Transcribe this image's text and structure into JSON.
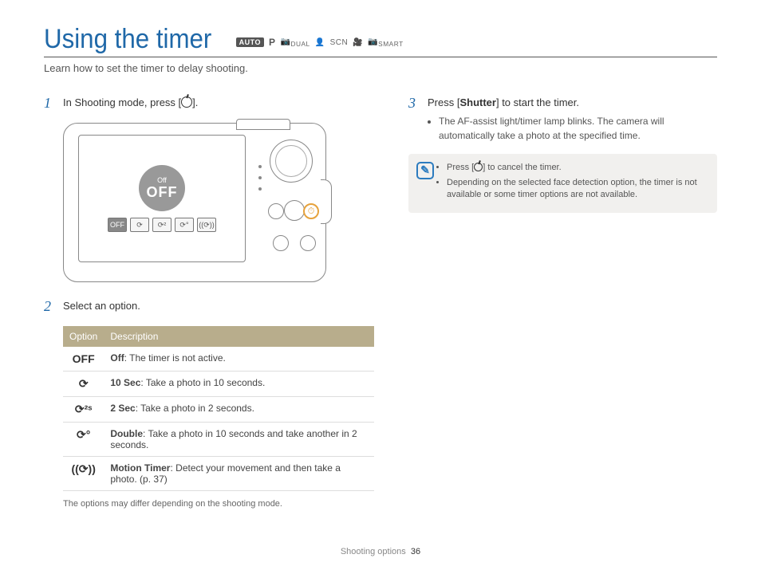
{
  "header": {
    "title": "Using the timer",
    "mode_badges": {
      "auto": "AUTO",
      "p": "P",
      "dual": "DUAL",
      "scn": "SCN",
      "smart": "SMART"
    },
    "subtitle": "Learn how to set the timer to delay shooting."
  },
  "steps": {
    "s1": {
      "num": "1",
      "text_pre": "In Shooting mode, press [",
      "text_post": "]."
    },
    "s2": {
      "num": "2",
      "text": "Select an option."
    },
    "s3": {
      "num": "3",
      "text_pre": "Press [",
      "shutter": "Shutter",
      "text_post": "] to start the timer.",
      "bullet": "The AF-assist light/timer lamp blinks. The camera will automatically take a photo at the specified time."
    }
  },
  "camera_lcd": {
    "off_small": "Off",
    "off_big": "OFF",
    "icons": [
      "OFF",
      "⟳",
      "⟳²",
      "⟳°",
      "((⟳))"
    ]
  },
  "table": {
    "col1": "Option",
    "col2": "Description",
    "rows": [
      {
        "icon": "OFF",
        "label": "Off",
        "desc": ": The timer is not active."
      },
      {
        "icon": "⟳",
        "label": "10 Sec",
        "desc": ": Take a photo in 10 seconds."
      },
      {
        "icon": "⟳²ˢ",
        "label": "2 Sec",
        "desc": ": Take a photo in 2 seconds."
      },
      {
        "icon": "⟳°",
        "label": "Double",
        "desc": ": Take a photo in 10 seconds and take another in 2 seconds."
      },
      {
        "icon": "((⟳))",
        "label": "Motion Timer",
        "desc": ": Detect your movement and then take a photo. (p. 37)"
      }
    ],
    "note": "The options may differ depending on the shooting mode."
  },
  "notebox": {
    "b1_pre": "Press [",
    "b1_post": "] to cancel the timer.",
    "b2": "Depending on the selected face detection option, the timer is not available or some timer options are not available."
  },
  "footer": {
    "section": "Shooting options",
    "page": "36"
  }
}
